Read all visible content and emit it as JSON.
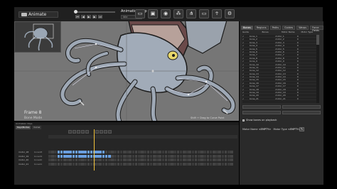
{
  "toolbar": {
    "app_label": "Animate",
    "clip_title": "Animation Clip",
    "clip_field": "Idle",
    "buttons": {
      "first": "⏮",
      "prev": "◀",
      "play": "▶",
      "next": "▶",
      "last": "⏭"
    },
    "tools": [
      {
        "name": "present-tool",
        "icon": "screen-icon",
        "glyph": "▭"
      },
      {
        "name": "stage-tool",
        "icon": "stage-icon",
        "glyph": "▣"
      },
      {
        "name": "snapshot-tool",
        "icon": "camera-icon",
        "glyph": "◉"
      },
      {
        "name": "bones-tool",
        "icon": "bones-icon",
        "glyph": "⁂"
      },
      {
        "name": "ik-tool",
        "icon": "hierarchy-icon",
        "glyph": "⋔"
      },
      {
        "name": "view-tool",
        "icon": "monitor-icon",
        "glyph": "▭"
      },
      {
        "name": "pose-tool",
        "icon": "figure-icon",
        "glyph": "☥"
      },
      {
        "name": "settings-tool",
        "icon": "gear-icon",
        "glyph": "⚙"
      }
    ]
  },
  "viewport": {
    "frame": "Frame 8",
    "mode": "Bone Mode",
    "hint": "Shift + Drag to Curve Point"
  },
  "panel": {
    "tabs": [
      "Bones",
      "Regions",
      "Paths",
      "Guides",
      "Warps",
      "Force Fields"
    ],
    "columns": [
      "Guide",
      "Bones",
      "Motor Name",
      "Motor Type"
    ],
    "rows": [
      {
        "c1": "bone_1",
        "c2": "motor_1",
        "c3": "0"
      },
      {
        "c1": "bone_2",
        "c2": "motor_2",
        "c3": "0"
      },
      {
        "c1": "bone_3",
        "c2": "motor_3",
        "c3": "0"
      },
      {
        "c1": "bone_4",
        "c2": "motor_4",
        "c3": "0"
      },
      {
        "c1": "bone_5",
        "c2": "motor_5",
        "c3": "0"
      },
      {
        "c1": "bone_6",
        "c2": "motor_6",
        "c3": "0"
      },
      {
        "c1": "bone_7",
        "c2": "motor_7",
        "c3": "0"
      },
      {
        "c1": "bone_8",
        "c2": "motor_8",
        "c3": "0"
      },
      {
        "c1": "bone_9",
        "c2": "motor_9",
        "c3": "0"
      },
      {
        "c1": "bone_10",
        "c2": "motor_10",
        "c3": "0"
      },
      {
        "c1": "bone_11",
        "c2": "motor_11",
        "c3": "0"
      },
      {
        "c1": "bone_12",
        "c2": "motor_12",
        "c3": "0"
      },
      {
        "c1": "bone_13",
        "c2": "motor_13",
        "c3": "0"
      },
      {
        "c1": "bone_14",
        "c2": "motor_14",
        "c3": "0"
      },
      {
        "c1": "bone_15",
        "c2": "motor_15",
        "c3": "0"
      },
      {
        "c1": "bone_16",
        "c2": "motor_16",
        "c3": "0"
      },
      {
        "c1": "bone_17",
        "c2": "motor_17",
        "c3": "0"
      },
      {
        "c1": "bone_18",
        "c2": "motor_18",
        "c3": "0"
      },
      {
        "c1": "bone_19",
        "c2": "motor_19",
        "c3": "0"
      },
      {
        "c1": "bone_20",
        "c2": "motor_20",
        "c3": "0"
      },
      {
        "c1": "bone_21",
        "c2": "motor_21",
        "c3": "0"
      }
    ],
    "show_bones": "Show bones on playback",
    "motor_name_label": "Motor Name",
    "motor_name_value": "<EMPTY>",
    "motor_type_label": "Motor Type",
    "motor_type_value": "<EMPTY>"
  },
  "timeline": {
    "header": "Animation Clips",
    "tabs": [
      "Keys/Nodes",
      "Curve"
    ],
    "tracks": [
      {
        "label": "motor_18",
        "sub": "bone18",
        "first": 3,
        "count": 16
      },
      {
        "label": "motor_19",
        "sub": "bone19",
        "first": 3,
        "count": 18
      },
      {
        "label": "motor_20",
        "sub": "bone20",
        "first": 3,
        "count": 0
      },
      {
        "label": "motor_21",
        "sub": "bone21",
        "first": 3,
        "count": 0
      }
    ]
  },
  "colors": {
    "key_active": "#6a9fe0",
    "playhead": "#f2c23a",
    "squid_body": "#9aa6b4",
    "outline": "#1a1a1a"
  }
}
